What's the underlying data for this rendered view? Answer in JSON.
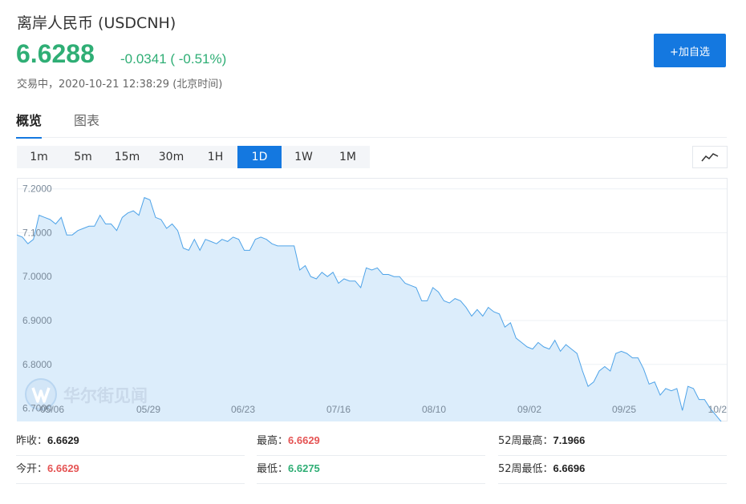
{
  "header": {
    "title": "离岸人民币 (USDCNH)",
    "price": "6.6288",
    "change": "-0.0341 ( -0.51%)",
    "status": "交易中，2020-10-21 12:38:29 (北京时间)",
    "add_button": "+加自选"
  },
  "tabs": [
    {
      "label": "概览",
      "active": true
    },
    {
      "label": "图表",
      "active": false
    }
  ],
  "periods": [
    {
      "label": "1m",
      "active": false
    },
    {
      "label": "5m",
      "active": false
    },
    {
      "label": "15m",
      "active": false
    },
    {
      "label": "30m",
      "active": false
    },
    {
      "label": "1H",
      "active": false
    },
    {
      "label": "1D",
      "active": true
    },
    {
      "label": "1W",
      "active": false
    },
    {
      "label": "1M",
      "active": false
    }
  ],
  "chart_toggle_icon": "line-chart-icon",
  "watermark": "华尔街见闻",
  "chart_data": {
    "type": "area",
    "title": "",
    "xlabel": "",
    "ylabel": "",
    "ylim": [
      6.67,
      7.225
    ],
    "yticks": [
      "7.2000",
      "7.1000",
      "7.0000",
      "6.9000",
      "6.8000",
      "6.7000"
    ],
    "ytick_values": [
      7.2,
      7.1,
      7.0,
      6.9,
      6.8,
      6.7
    ],
    "xticks": [
      "05/06",
      "05/29",
      "06/23",
      "07/16",
      "08/10",
      "09/02",
      "09/25",
      "10/2"
    ],
    "series": [
      {
        "values": [
          7.095,
          7.09,
          7.075,
          7.085,
          7.14,
          7.135,
          7.13,
          7.12,
          7.135,
          7.095,
          7.095,
          7.105,
          7.11,
          7.115,
          7.115,
          7.14,
          7.12,
          7.12,
          7.105,
          7.135,
          7.145,
          7.15,
          7.14,
          7.18,
          7.175,
          7.135,
          7.13,
          7.11,
          7.12,
          7.105,
          7.065,
          7.06,
          7.085,
          7.06,
          7.085,
          7.08,
          7.075,
          7.085,
          7.08,
          7.09,
          7.085,
          7.06,
          7.06,
          7.085,
          7.09,
          7.085,
          7.075,
          7.07,
          7.07,
          7.07,
          7.07,
          7.015,
          7.025,
          7.0,
          6.995,
          7.01,
          7.0,
          7.01,
          6.985,
          6.995,
          6.99,
          6.99,
          6.975,
          7.02,
          7.015,
          7.02,
          7.005,
          7.005,
          7.0,
          7.0,
          6.985,
          6.98,
          6.975,
          6.945,
          6.945,
          6.975,
          6.965,
          6.945,
          6.94,
          6.95,
          6.945,
          6.93,
          6.91,
          6.925,
          6.91,
          6.93,
          6.92,
          6.915,
          6.885,
          6.895,
          6.86,
          6.85,
          6.84,
          6.835,
          6.85,
          6.84,
          6.835,
          6.855,
          6.83,
          6.845,
          6.835,
          6.825,
          6.785,
          6.75,
          6.76,
          6.785,
          6.795,
          6.785,
          6.825,
          6.83,
          6.825,
          6.815,
          6.815,
          6.79,
          6.755,
          6.76,
          6.73,
          6.745,
          6.74,
          6.745,
          6.695,
          6.75,
          6.745,
          6.72,
          6.72,
          6.7,
          6.685,
          6.6696,
          6.6275
        ]
      }
    ],
    "fill_color": "#dcedfb",
    "line_color": "#4ea3e8",
    "grid": true
  },
  "stats": [
    {
      "label": "昨收：",
      "value": "6.6629",
      "color": "dark"
    },
    {
      "label": "最高：",
      "value": "6.6629",
      "color": "red"
    },
    {
      "label": "52周最高：",
      "value": "7.1966",
      "color": "dark"
    },
    {
      "label": "今开：",
      "value": "6.6629",
      "color": "red"
    },
    {
      "label": "最低：",
      "value": "6.6275",
      "color": "green"
    },
    {
      "label": "52周最低：",
      "value": "6.6696",
      "color": "dark"
    }
  ]
}
